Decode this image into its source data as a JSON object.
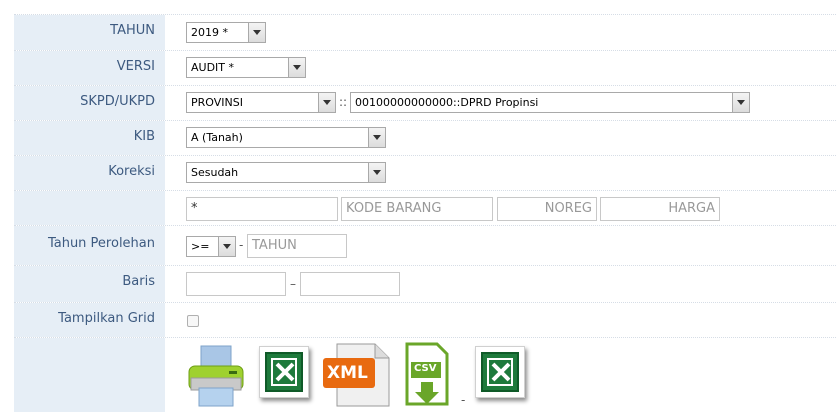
{
  "fields": {
    "tahun": {
      "label": "TAHUN",
      "value": "2019 *"
    },
    "versi": {
      "label": "VERSI",
      "value": "AUDIT *"
    },
    "skpd": {
      "label": "SKPD/UKPD",
      "value": "PROVINSI",
      "separator": "::",
      "unit_value": "00100000000000::DPRD Propinsi"
    },
    "kib": {
      "label": "KIB",
      "value": "A (Tanah)"
    },
    "koreksi": {
      "label": "Koreksi",
      "value": "Sesudah"
    },
    "filter": {
      "asterisk": "*",
      "kode_barang_placeholder": "KODE BARANG",
      "noreg_placeholder": "NOREG",
      "harga_placeholder": "HARGA"
    },
    "tahun_perolehan": {
      "label": "Tahun Perolehan",
      "operator": ">=",
      "dash": "-",
      "tahun_placeholder": "TAHUN"
    },
    "baris": {
      "label": "Baris",
      "dash": "–"
    },
    "tampilkan_grid": {
      "label": "Tampilkan Grid"
    }
  },
  "exports": {
    "xml_label": "XML",
    "csv_label": "CSV",
    "dash": "-",
    "icons": [
      "printer-icon",
      "excel-icon",
      "xml-file-icon",
      "csv-download-icon",
      "excel-icon"
    ]
  },
  "colors": {
    "label_background": "#e6eef6",
    "label_text": "#3d5a80",
    "excel_green": "#1e7a3c",
    "xml_orange": "#e86a10",
    "csv_green": "#6aa629"
  }
}
